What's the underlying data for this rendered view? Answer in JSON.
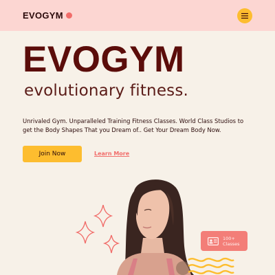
{
  "header": {
    "logo_text": "EVOGYM",
    "menu_icon": "hamburger-menu-icon",
    "colors": {
      "background": "#fcd6d2",
      "logo_dot": "#f16d6a",
      "menu_button": "#fdbd2f"
    }
  },
  "hero": {
    "title": "EVOGYM",
    "subtitle": "evolutionary fitness.",
    "description": "Unrivaled Gym. Unparalleled Training Fitness Classes. World Class Studios to get the Body Shapes That you Dream of.. Get Your Dream Body Now.",
    "join_label": "Join Now",
    "learn_label": "Learn More"
  },
  "stats_card": {
    "icon": "id-card-icon",
    "line1": "100+",
    "line2": "Classes"
  },
  "colors": {
    "page_background": "#f7f1e8",
    "title": "#5b0d0a",
    "accent_yellow": "#fdbd2f",
    "accent_coral": "#f16d6a"
  }
}
